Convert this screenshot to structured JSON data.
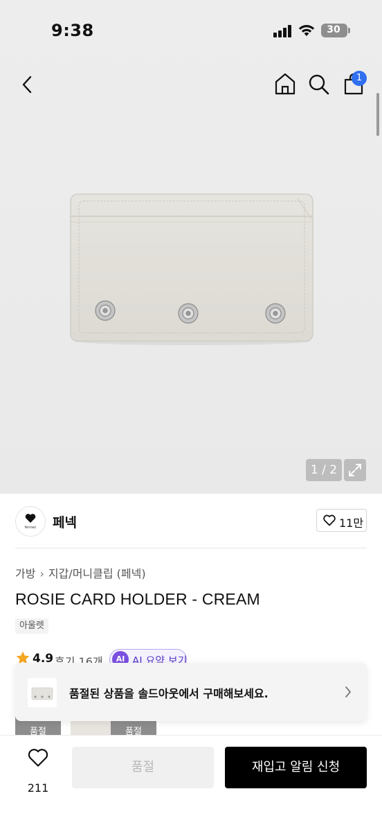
{
  "status_bar": {
    "time": "9:38",
    "battery": "30"
  },
  "header": {
    "back_icon": "chevron-left-icon",
    "home_icon": "home-icon",
    "search_icon": "search-icon",
    "cart_icon": "shopping-bag-icon",
    "cart_badge": "1",
    "badge_color": "#2f6ff0"
  },
  "gallery": {
    "page_indicator": "1 / 2",
    "current_page": 1,
    "total_pages": 2,
    "expand_icon": "expand-icon"
  },
  "brand": {
    "name": "페넥",
    "logo_text": "fennec",
    "like_count": "11만"
  },
  "product": {
    "breadcrumb": [
      "가방",
      "지갑/머니클립 (페넥)"
    ],
    "title": "ROSIE CARD HOLDER - CREAM",
    "tag": "아울렛",
    "rating": "4.9",
    "reviews": "후기 16개",
    "ai_icon_text": "AI",
    "ai_label": "AI 요약 보기",
    "ai_color": "#7a4fe0"
  },
  "thumbnails": [
    {
      "label": "품절"
    },
    {
      "label": ""
    },
    {
      "label": "품절"
    }
  ],
  "soldout_banner": {
    "text": "품절된 상품을 솔드아웃에서 구매해보세요."
  },
  "action_bar": {
    "wishlist_count": "211",
    "soldout_label": "품절",
    "restock_label": "재입고 알림 신청"
  }
}
